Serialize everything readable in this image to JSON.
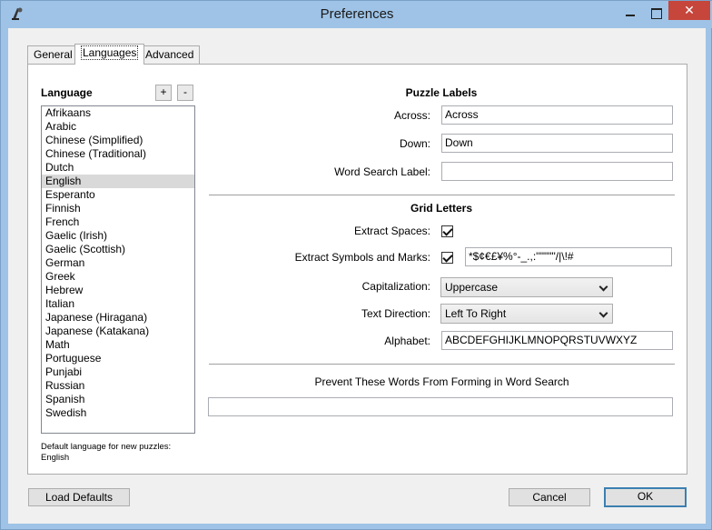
{
  "window": {
    "title": "Preferences",
    "close_glyph": "✕"
  },
  "tabs": [
    {
      "label": "General"
    },
    {
      "label": "Languages",
      "active": true
    },
    {
      "label": "Advanced"
    }
  ],
  "language_panel": {
    "heading": "Language",
    "add_label": "+",
    "remove_label": "-",
    "items": [
      "Afrikaans",
      "Arabic",
      "Chinese (Simplified)",
      "Chinese (Traditional)",
      "Dutch",
      "English",
      "Esperanto",
      "Finnish",
      "French",
      "Gaelic (Irish)",
      "Gaelic (Scottish)",
      "German",
      "Greek",
      "Hebrew",
      "Italian",
      "Japanese (Hiragana)",
      "Japanese (Katakana)",
      "Math",
      "Portuguese",
      "Punjabi",
      "Russian",
      "Spanish",
      "Swedish"
    ],
    "selected": "English",
    "default_note_line1": "Default language for new puzzles:",
    "default_note_line2": "English"
  },
  "puzzle_labels": {
    "title": "Puzzle Labels",
    "across_label": "Across:",
    "across_value": "Across",
    "down_label": "Down:",
    "down_value": "Down",
    "word_search_label": "Word Search Label:",
    "word_search_value": ""
  },
  "grid_letters": {
    "title": "Grid Letters",
    "extract_spaces_label": "Extract Spaces:",
    "extract_spaces_checked": true,
    "extract_symbols_label": "Extract Symbols and Marks:",
    "extract_symbols_checked": true,
    "symbols_value": "*$¢€£¥%°-_.,:''\"\"\"\"/|\\!#",
    "capitalization_label": "Capitalization:",
    "capitalization_value": "Uppercase",
    "text_direction_label": "Text Direction:",
    "text_direction_value": "Left To Right",
    "alphabet_label": "Alphabet:",
    "alphabet_value": "ABCDEFGHIJKLMNOPQRSTUVWXYZ"
  },
  "prevent_words": {
    "label": "Prevent These Words From Forming in Word Search",
    "value": ""
  },
  "buttons": {
    "load_defaults": "Load Defaults",
    "cancel": "Cancel",
    "ok": "OK"
  }
}
